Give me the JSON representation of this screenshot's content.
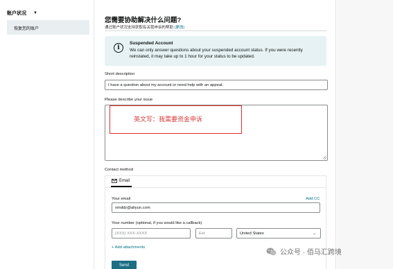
{
  "sidebar": {
    "heading": "账户状况",
    "heading_caret": "▼",
    "item": "恢复您的账户"
  },
  "main": {
    "title": "您需要协助解决什么问题?",
    "subtitle": "通过账户状况支持获取有关我申诉的帮助",
    "subtitle_link": "(更改)"
  },
  "banner": {
    "icon": "info-icon",
    "icon_glyph": "i",
    "title": "Suspended Account",
    "text": "We can only answer questions about your suspended account status. If you were recently reinstated, it may take up to 1 hour for your status to be updated."
  },
  "short_description": {
    "label": "Short description",
    "value": "I have a question about my account or need help with an appeal."
  },
  "issue": {
    "label": "Please describe your issue",
    "value": ""
  },
  "annotation": {
    "text": "英文写：我需要资金申诉",
    "color": "#e22b2b"
  },
  "contact": {
    "label": "Contact method",
    "tab_icon": "mail-icon",
    "tab_label": "Email",
    "email_label": "Your email",
    "add_cc": "Add CC",
    "email_value": "xmddz@aliyun.com",
    "number_label": "Your number (optional, if you would like a callback)",
    "phone_placeholder": "(XXX) XXX-XXXX",
    "ext_placeholder": "Ext",
    "country_value": "United States",
    "attach_label": "+ Add attachments",
    "send_label": "Send"
  },
  "watermark": {
    "text": "公众号 · 佰马汇跨境"
  },
  "colors": {
    "accent": "#007185",
    "banner_bg": "#e6f2f3",
    "send_bg": "#1b6e83"
  }
}
